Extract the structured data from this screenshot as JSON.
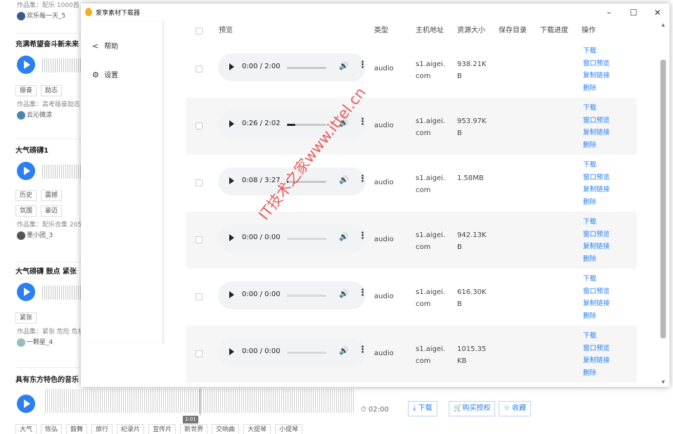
{
  "background": {
    "items": [
      {
        "meta": "作品集：配乐 1000首",
        "author": "欢乐每一天_5",
        "avatar_color": "#3a5a8a"
      },
      {
        "title": "充满希望奋斗新未来",
        "tags": [
          "振奋",
          "励志"
        ],
        "meta": "作品集：高考振奋励志",
        "author": "云沁微凉",
        "avatar_color": "#4a8ab0"
      },
      {
        "title": "大气磅礴1",
        "tags": [
          "历史",
          "震撼",
          "氛围",
          "豪迈"
        ],
        "meta": "作品集：配乐合集 205",
        "author": "墨小团_3",
        "avatar_color": "#555"
      },
      {
        "title": "大气磅礴 鼓点 紧张",
        "tags": [
          "紧张"
        ],
        "meta": "作品集：紧张 危险 危机",
        "author": "一颗星_4",
        "avatar_color": "#9bb"
      }
    ],
    "bottom": {
      "title": "具有东方特色的音乐",
      "duration": "02:00",
      "time_tip": "1:01",
      "download": "下载",
      "buy": "购买授权",
      "favorite": "收藏",
      "tags": [
        "大气",
        "恢弘",
        "鼓舞",
        "旅行",
        "纪录片",
        "宣传片",
        "新世界",
        "交响曲",
        "大提琴",
        "小提琴"
      ]
    }
  },
  "window": {
    "title": "爱享素材下载器",
    "controls": {
      "minimize": "–",
      "maximize": "☐",
      "close": "✕"
    },
    "sidebar": [
      {
        "icon": "share-icon",
        "glyph": "<",
        "label": "帮助"
      },
      {
        "icon": "gear-icon",
        "glyph": "⚙",
        "label": "设置"
      }
    ],
    "columns": [
      "预览",
      "类型",
      "主机地址",
      "资源大小",
      "保存目录",
      "下载进度",
      "操作"
    ],
    "rows": [
      {
        "time": "0:00 / 2:00",
        "progress": 0.0,
        "disabled": false,
        "type": "audio",
        "host": [
          "s1.aigei.",
          "com"
        ],
        "size": [
          "938.21K",
          "B"
        ]
      },
      {
        "time": "0:26 / 2:02",
        "progress": 0.21,
        "disabled": false,
        "type": "audio",
        "host": [
          "s1.aigei.",
          "com"
        ],
        "size": [
          "953.97K",
          "B"
        ]
      },
      {
        "time": "0:08 / 3:27",
        "progress": 0.04,
        "disabled": false,
        "type": "audio",
        "host": [
          "s1.aigei.",
          "com"
        ],
        "size": [
          "1.58MB",
          ""
        ]
      },
      {
        "time": "0:00 / 0:00",
        "progress": 0.0,
        "disabled": true,
        "type": "audio",
        "host": [
          "s1.aigei.",
          "com"
        ],
        "size": [
          "942.13K",
          "B"
        ]
      },
      {
        "time": "0:00 / 0:00",
        "progress": 0.0,
        "disabled": true,
        "type": "audio",
        "host": [
          "s1.aigei.",
          "com"
        ],
        "size": [
          "616.30K",
          "B"
        ]
      },
      {
        "time": "0:00 / 0:00",
        "progress": 0.0,
        "disabled": true,
        "type": "audio",
        "host": [
          "s1.aigei.",
          "com"
        ],
        "size": [
          "1015.35",
          "KB"
        ]
      }
    ],
    "actions": [
      "下载",
      "窗口预览",
      "复制链接",
      "删除"
    ]
  },
  "watermark": "IT技术之家www.ittel.cn",
  "colors": {
    "accent": "#2a7ff3",
    "row_alt": "#f6f6f6",
    "watermark": "#e62828"
  }
}
